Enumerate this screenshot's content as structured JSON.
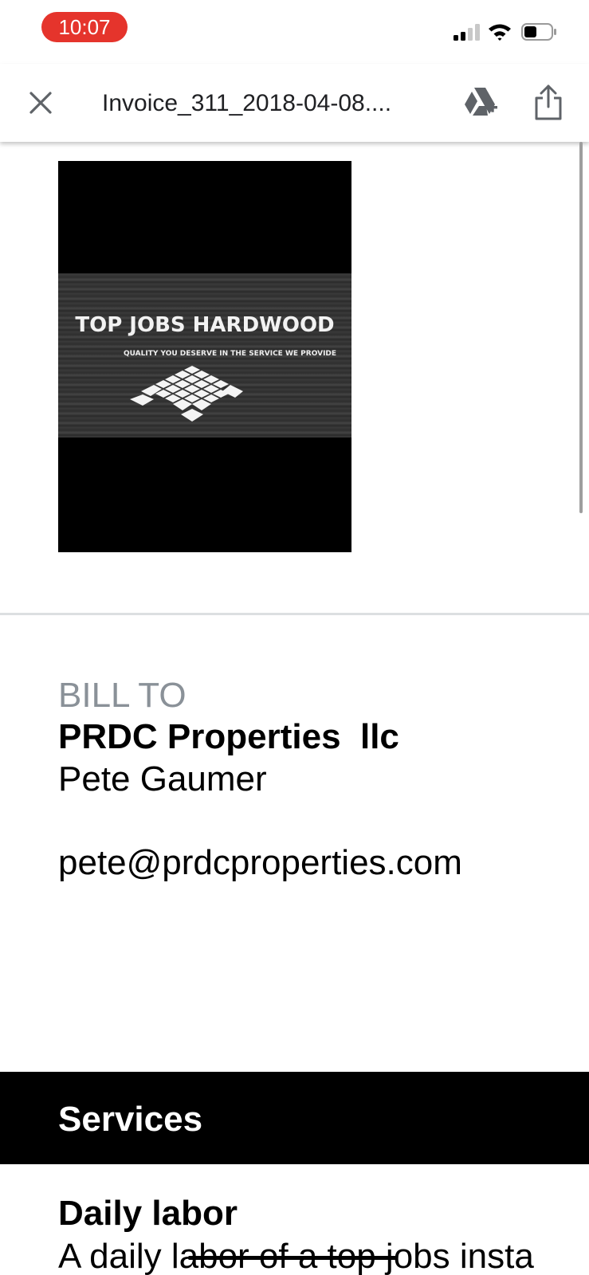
{
  "status_bar": {
    "time": "10:07",
    "time_pill_color": "#e5342c",
    "icons": [
      "cellular-signal-icon",
      "wifi-icon",
      "battery-icon"
    ]
  },
  "header": {
    "close_icon": "close-icon",
    "title": "Invoice_311_2018-04-08....",
    "drive_icon": "drive-add-icon",
    "share_icon": "share-icon"
  },
  "logo": {
    "title": "TOP JOBS HARDWOOD",
    "tagline": "QUALITY YOU DESERVE IN THE SERVICE WE PROVIDE"
  },
  "bill_to": {
    "label": "BILL TO",
    "company": "PRDC Properties  llc",
    "contact": "Pete Gaumer",
    "email": "pete@prdcproperties.com"
  },
  "services": {
    "heading": "Services",
    "items": [
      {
        "name": "Daily labor",
        "description": "A daily labor of a top jobs insta"
      }
    ]
  }
}
